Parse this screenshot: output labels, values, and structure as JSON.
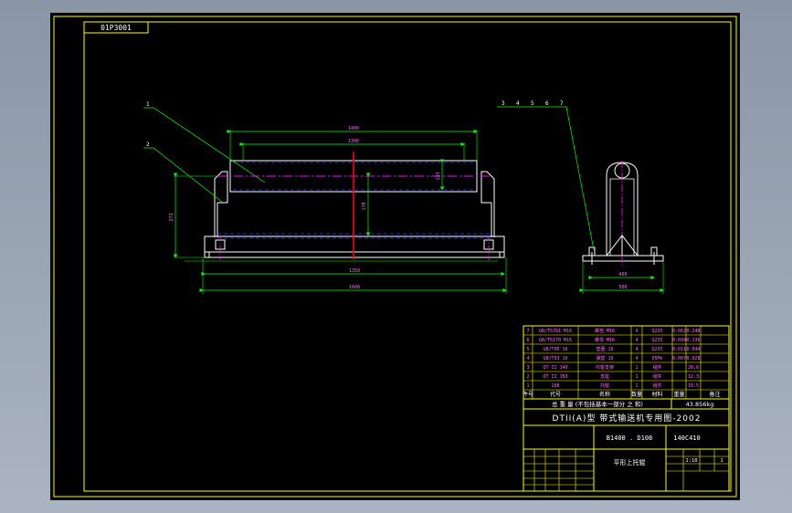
{
  "drawing": {
    "code_tag": "01P3001",
    "colors": {
      "background": "#000000",
      "frame": "#ffff00",
      "geometry": "#ffffff",
      "dimension": "#00ff00",
      "leader": "#00ff00",
      "centerline": "#ff00ff",
      "hidden": "#3b3bff",
      "axis": "#ff0000",
      "text": "#ff66ff"
    },
    "callouts": {
      "front": [
        "1",
        "2"
      ],
      "side": [
        "3",
        "4",
        "5",
        "6",
        "7"
      ]
    },
    "dimensions": {
      "front_top_outer": "1400",
      "front_top_inner": "1300",
      "front_height": "273",
      "front_mid": "170",
      "front_right_small": "133",
      "front_bottom_inner": "1350",
      "front_bottom_outer": "1600",
      "side_bottom_inner": "400",
      "side_bottom_outer": "500"
    },
    "parts_table": {
      "rows": [
        {
          "no": "7",
          "code": "GB/T5781 M16",
          "name": "螺栓 M16",
          "qty": "4",
          "material": "Q235",
          "wt": "0.062",
          "total": "0.248"
        },
        {
          "no": "6",
          "code": "GB/T6170 M16",
          "name": "螺母 M16",
          "qty": "4",
          "material": "Q235",
          "wt": "0.034",
          "total": "0.136"
        },
        {
          "no": "5",
          "code": "GB/T95 16",
          "name": "垫圈 16",
          "qty": "4",
          "material": "Q235",
          "wt": "0.011",
          "total": "0.044"
        },
        {
          "no": "4",
          "code": "GB/T93 16",
          "name": "弹垫 16",
          "qty": "4",
          "material": "65Mn",
          "wt": "0.007",
          "total": "0.028"
        },
        {
          "no": "3",
          "code": "DT II 140",
          "name": "托辊支架",
          "qty": "1",
          "material": "组件",
          "wt": "",
          "total": "20.6"
        },
        {
          "no": "2",
          "code": "DT II 150",
          "name": "支座",
          "qty": "1",
          "material": "组件",
          "wt": "",
          "total": "12.3"
        },
        {
          "no": "1",
          "code": "108",
          "name": "托辊",
          "qty": "1",
          "material": "组件",
          "wt": "",
          "total": "10.5"
        }
      ],
      "header": {
        "no": "件号",
        "code": "代号",
        "name": "名称",
        "qty": "数量",
        "material": "材料",
        "weight": "重量",
        "note": "备注"
      },
      "summary": "总 重 量 (不包括基本一部分 之 和)",
      "total_weight": "43.856kg"
    },
    "title_block": {
      "series_title": "DTII(A)型 带式输送机专用图-2002",
      "drawing_no": "B1400 . D108",
      "model": "140C410",
      "drawing_name": "平形上托辊",
      "scale": "1:10",
      "sheet": "1"
    }
  }
}
